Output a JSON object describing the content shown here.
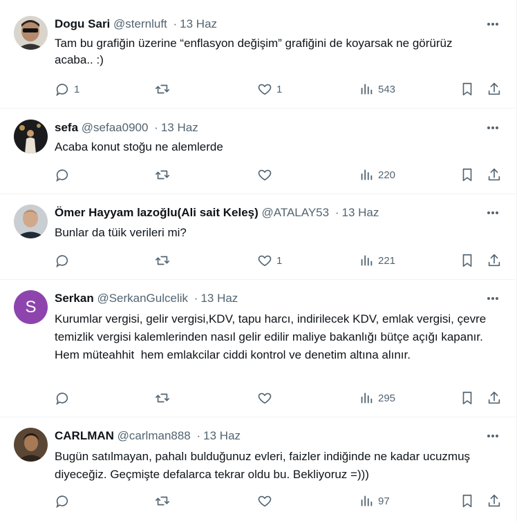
{
  "tweets": [
    {
      "name": "Dogu Sari",
      "handle": "@sternluft",
      "dot": "·",
      "time": "13 Haz",
      "text": "Tam bu grafiğin üzerine “enflasyon değişim” grafiğini de koyarsak ne görürüz acaba.. :)",
      "replies": "1",
      "retweets": "",
      "likes": "1",
      "views": "543"
    },
    {
      "name": "sefa",
      "handle": "@sefaa0900",
      "dot": "·",
      "time": "13 Haz",
      "text": "Acaba konut stoğu ne alemlerde",
      "replies": "",
      "retweets": "",
      "likes": "",
      "views": "220"
    },
    {
      "name": "Ömer Hayyam lazoğlu(Ali sait Keleş)",
      "handle": "@ATALAY53",
      "dot": "·",
      "time": "13 Haz",
      "text": "Bunlar da tüik verileri mi?",
      "replies": "",
      "retweets": "",
      "likes": "1",
      "views": "221"
    },
    {
      "name": "Serkan",
      "handle": "@SerkanGulcelik",
      "dot": "·",
      "time": "13 Haz",
      "avatar_letter": "S",
      "text": "Kurumlar vergisi, gelir vergisi,KDV, tapu harcı, indirilecek KDV, emlak vergisi, çevre temizlik vergisi kalemlerinden nasıl gelir edilir maliye bakanlığı bütçe açığı kapanır. Hem müteahhit  hem emlakcilar ciddi kontrol ve denetim altına alınır.",
      "replies": "",
      "retweets": "",
      "likes": "",
      "views": "295"
    },
    {
      "name": "CARLMAN",
      "handle": "@carlman888",
      "dot": "·",
      "time": "13 Haz",
      "text": "Bugün satılmayan, pahalı bulduğunuz evleri, faizler indiğinde ne kadar ucuzmuş diyeceğiz. Geçmişte defalarca tekrar oldu bu. Bekliyoruz =)))",
      "replies": "",
      "retweets": "",
      "likes": "",
      "views": "97"
    }
  ],
  "icons": {
    "reply": "reply-icon",
    "retweet": "retweet-icon",
    "like": "heart-icon",
    "views": "views-icon",
    "bookmark": "bookmark-icon",
    "share": "share-icon",
    "more": "more-icon"
  },
  "colors": {
    "text": "#0f1419",
    "secondary": "#536471",
    "divider": "#eff3f4",
    "serkan_avatar": "#8e44ad"
  }
}
